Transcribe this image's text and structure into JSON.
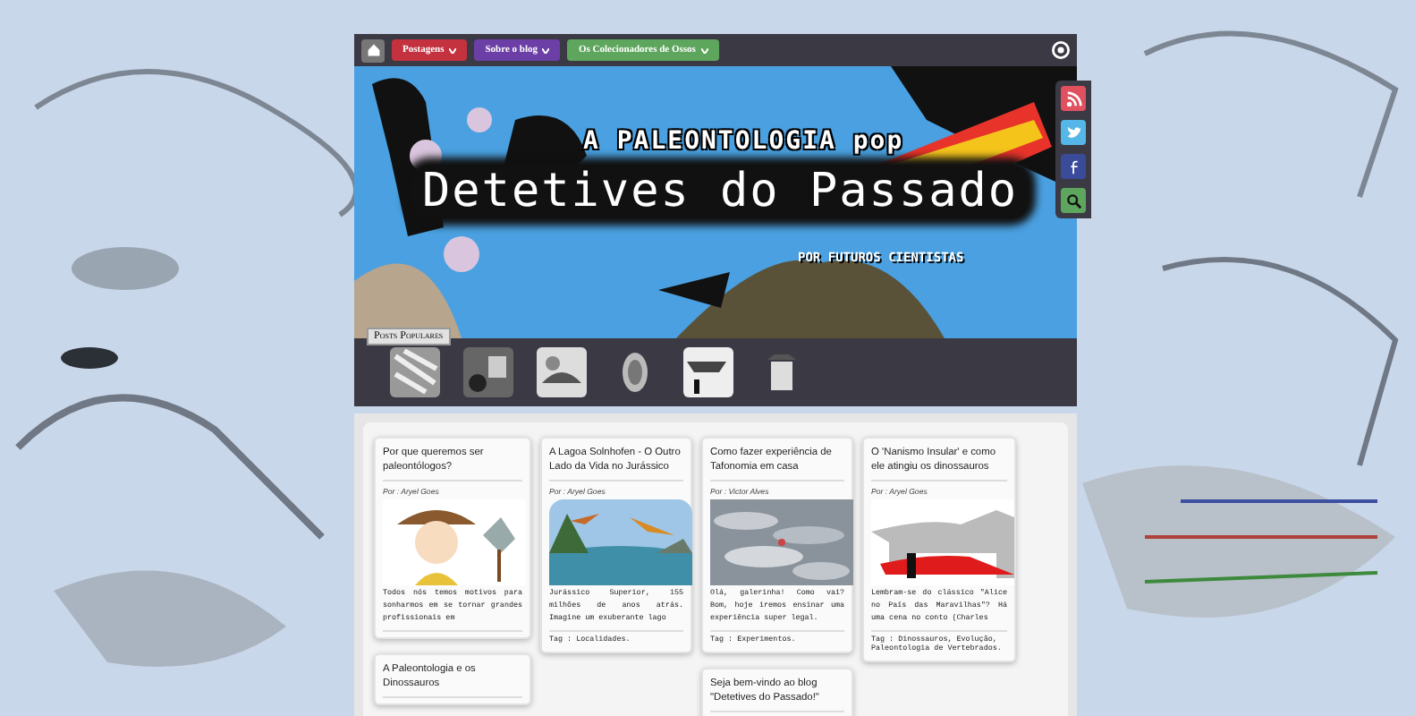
{
  "nav": {
    "menus": [
      {
        "label": "Postagens",
        "color": "#c4323f"
      },
      {
        "label": "Sobre o blog",
        "color": "#6b3fa6"
      },
      {
        "label": "Os Colecionadores de Ossos",
        "color": "#5ea65e"
      }
    ]
  },
  "banner": {
    "kicker": "A PALEONTOLOGIA pop",
    "title": "Detetives do Passado",
    "subtitle": "POR FUTUROS CIENTISTAS"
  },
  "social": [
    {
      "kind": "rss",
      "color": "#e0505e"
    },
    {
      "kind": "twitter",
      "color": "#55b7e8"
    },
    {
      "kind": "facebook",
      "color": "#3a4b9a"
    },
    {
      "kind": "search",
      "color": "#5ea65e"
    }
  ],
  "popular": {
    "label": "Posts Populares"
  },
  "columns": [
    {
      "posts": [
        {
          "title": "Por que queremos ser paleontólogos?",
          "author": "Por : Aryel Goes",
          "excerpt": "Todos nós temos motivos para sonharmos em se tornar grandes profissionais em"
        },
        {
          "title": "A Paleontologia e os Dinossauros"
        }
      ]
    },
    {
      "posts": [
        {
          "title": "A Lagoa Solnhofen - O Outro Lado da Vida no Jurássico",
          "author": "Por : Aryel Goes",
          "excerpt": "Jurássico Superior, 155 milhões de anos atrás. Imagine um exuberante lago",
          "tags": "Tag : Localidades."
        }
      ]
    },
    {
      "posts": [
        {
          "title": "Como fazer experiência de Tafonomia em casa",
          "author": "Por : Victor Alves",
          "excerpt": "Olá, galerinha! Como vai? Bom, hoje iremos ensinar uma experiência super legal.",
          "tags": "Tag : Experimentos."
        },
        {
          "title": "Seja bem-vindo ao blog \"Detetives do Passado!\""
        }
      ]
    },
    {
      "posts": [
        {
          "title": "O 'Nanismo Insular' e como ele atingiu os dinossauros",
          "author": "Por : Aryel Goes",
          "excerpt": "Lembram-se do clássico \"Alice no País das Maravilhas\"? Há uma cena no conto (Charles",
          "tags": "Tag : Dinossauros, Evolução, Paleontologia de Vertebrados."
        }
      ]
    }
  ]
}
